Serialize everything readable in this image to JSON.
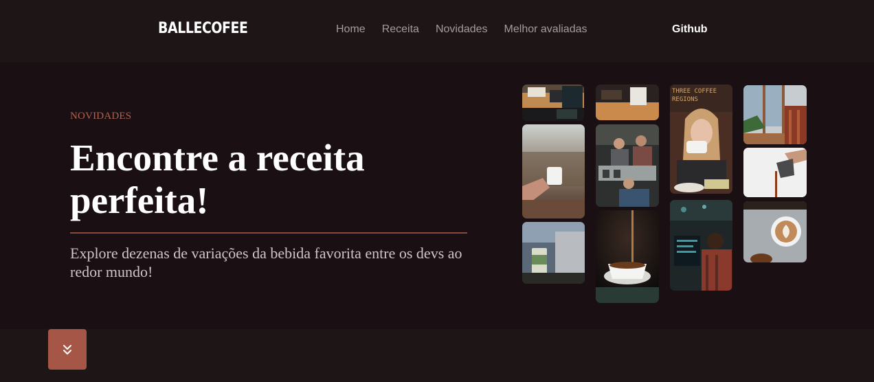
{
  "header": {
    "logo": "BALLECOFEE",
    "nav": [
      "Home",
      "Receita",
      "Novidades",
      "Melhor avaliadas"
    ],
    "github": "Github"
  },
  "hero": {
    "eyebrow": "NOVIDADES",
    "title": "Encontre a receita perfeita!",
    "subtitle": "Explore dezenas de variações da bebida favorita entre os devs ao redor mundo!"
  },
  "gallery": {
    "photos": [
      {
        "name": "cafe-table-photo",
        "caption": ""
      },
      {
        "name": "hand-holding-cup-photo",
        "caption": ""
      },
      {
        "name": "coffee-cup-laptop-photo",
        "caption": ""
      },
      {
        "name": "espresso-machine-top-photo",
        "caption": ""
      },
      {
        "name": "baristas-counter-photo",
        "caption": ""
      },
      {
        "name": "pouring-coffee-cup-photo",
        "caption": ""
      },
      {
        "name": "woman-drinking-coffee-photo",
        "caption": "THREE COFFEE REGIONS"
      },
      {
        "name": "developer-at-computer-photo",
        "caption": ""
      },
      {
        "name": "window-chair-photo",
        "caption": ""
      },
      {
        "name": "pouring-pot-photo",
        "caption": ""
      },
      {
        "name": "latte-art-photo",
        "caption": ""
      }
    ]
  },
  "scroll_button": {
    "icon": "chevrons-down-icon"
  },
  "colors": {
    "background": "#1e1516",
    "hero_background": "#1a1013",
    "accent": "#b3624f",
    "button": "#a55647"
  }
}
